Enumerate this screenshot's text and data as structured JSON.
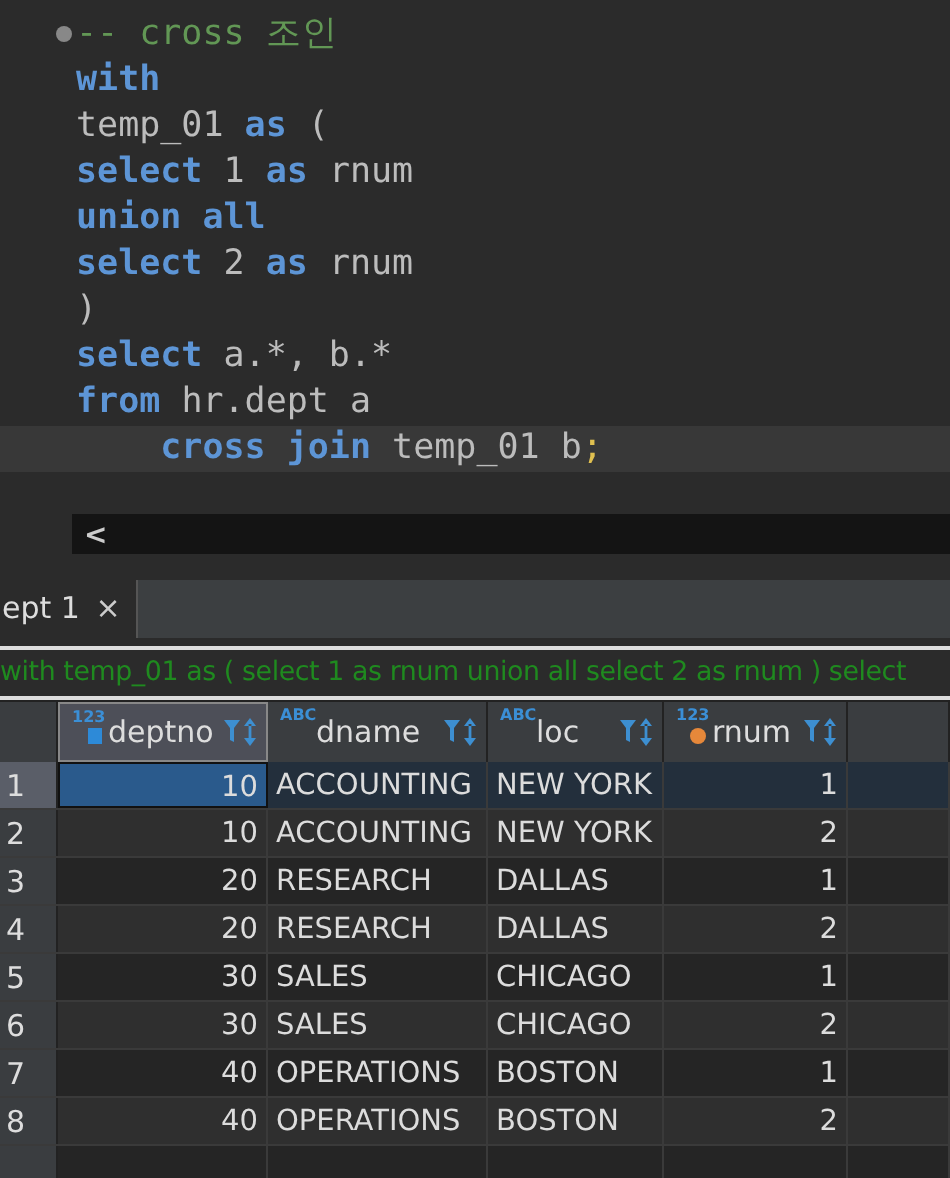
{
  "editor": {
    "lines": [
      {
        "current": false,
        "tokens": [
          {
            "kind": "comment",
            "text": "-- cross 조인"
          }
        ]
      },
      {
        "current": false,
        "tokens": [
          {
            "kind": "keyword",
            "text": "with"
          }
        ]
      },
      {
        "current": false,
        "tokens": [
          {
            "kind": "plain",
            "text": "temp_01 "
          },
          {
            "kind": "keyword",
            "text": "as"
          },
          {
            "kind": "plain",
            "text": " ("
          }
        ]
      },
      {
        "current": false,
        "tokens": [
          {
            "kind": "keyword",
            "text": "select"
          },
          {
            "kind": "plain",
            "text": " 1 "
          },
          {
            "kind": "keyword",
            "text": "as"
          },
          {
            "kind": "plain",
            "text": " rnum"
          }
        ]
      },
      {
        "current": false,
        "tokens": [
          {
            "kind": "keyword",
            "text": "union all"
          }
        ]
      },
      {
        "current": false,
        "tokens": [
          {
            "kind": "keyword",
            "text": "select"
          },
          {
            "kind": "plain",
            "text": " 2 "
          },
          {
            "kind": "keyword",
            "text": "as"
          },
          {
            "kind": "plain",
            "text": " rnum"
          }
        ]
      },
      {
        "current": false,
        "tokens": [
          {
            "kind": "plain",
            "text": ")"
          }
        ]
      },
      {
        "current": false,
        "tokens": [
          {
            "kind": "keyword",
            "text": "select"
          },
          {
            "kind": "plain",
            "text": " a.*, b.*"
          }
        ]
      },
      {
        "current": false,
        "tokens": [
          {
            "kind": "keyword",
            "text": "from"
          },
          {
            "kind": "plain",
            "text": " hr.dept a"
          }
        ]
      },
      {
        "current": true,
        "tokens": [
          {
            "kind": "keyword",
            "text": "    cross join"
          },
          {
            "kind": "plain",
            "text": " temp_01 b"
          },
          {
            "kind": "punct",
            "text": ";"
          }
        ]
      }
    ],
    "scroll_left": "<"
  },
  "tabs": [
    {
      "label": "ept 1",
      "close": "×",
      "selected": true
    }
  ],
  "query": "with temp_01 as ( select 1 as rnum union all select 2 as rnum ) select",
  "grid": {
    "columns": [
      {
        "name": "deptno",
        "type_label": "123",
        "kind": "key",
        "selected": true
      },
      {
        "name": "dname",
        "type_label": "ABC",
        "kind": "text",
        "selected": false
      },
      {
        "name": "loc",
        "type_label": "ABC",
        "kind": "text",
        "selected": false
      },
      {
        "name": "rnum",
        "type_label": "123",
        "kind": "computed",
        "selected": false
      }
    ],
    "rows": [
      {
        "num": "1",
        "selected": true,
        "cells": [
          "10",
          "ACCOUNTING",
          "NEW YORK",
          "1"
        ]
      },
      {
        "num": "2",
        "selected": false,
        "cells": [
          "10",
          "ACCOUNTING",
          "NEW YORK",
          "2"
        ]
      },
      {
        "num": "3",
        "selected": false,
        "cells": [
          "20",
          "RESEARCH",
          "DALLAS",
          "1"
        ]
      },
      {
        "num": "4",
        "selected": false,
        "cells": [
          "20",
          "RESEARCH",
          "DALLAS",
          "2"
        ]
      },
      {
        "num": "5",
        "selected": false,
        "cells": [
          "30",
          "SALES",
          "CHICAGO",
          "1"
        ]
      },
      {
        "num": "6",
        "selected": false,
        "cells": [
          "30",
          "SALES",
          "CHICAGO",
          "2"
        ]
      },
      {
        "num": "7",
        "selected": false,
        "cells": [
          "40",
          "OPERATIONS",
          "BOSTON",
          "1"
        ]
      },
      {
        "num": "8",
        "selected": false,
        "cells": [
          "40",
          "OPERATIONS",
          "BOSTON",
          "2"
        ]
      }
    ]
  }
}
